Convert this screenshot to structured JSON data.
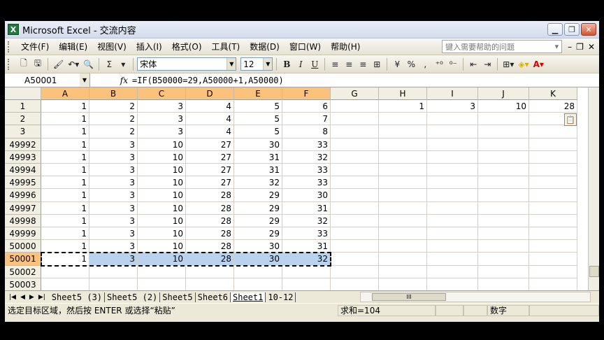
{
  "window": {
    "title": "Microsoft Excel - 交流内容"
  },
  "menu": {
    "items": [
      "文件(F)",
      "编辑(E)",
      "视图(V)",
      "插入(I)",
      "格式(O)",
      "工具(T)",
      "数据(D)",
      "窗口(W)",
      "帮助(H)"
    ],
    "help_placeholder": "键入需要帮助的问题"
  },
  "toolbar": {
    "font": "宋体",
    "size": "12",
    "sum_label": "Σ",
    "bold": "B",
    "italic": "I",
    "underline": "U",
    "percent": "%",
    "comma": ","
  },
  "formula_bar": {
    "name_box": "A50001",
    "fx": "fx",
    "formula": "=IF(B50000=29,A50000+1,A50000)"
  },
  "grid": {
    "columns": [
      "A",
      "B",
      "C",
      "D",
      "E",
      "F",
      "G",
      "H",
      "I",
      "J",
      "K"
    ],
    "rows": [
      {
        "label": "1",
        "cells": [
          "1",
          "2",
          "3",
          "4",
          "5",
          "6",
          "",
          "1",
          "3",
          "10",
          "28"
        ]
      },
      {
        "label": "2",
        "cells": [
          "1",
          "2",
          "3",
          "4",
          "5",
          "7",
          "",
          "",
          "",
          "",
          ""
        ]
      },
      {
        "label": "3",
        "cells": [
          "1",
          "2",
          "3",
          "4",
          "5",
          "8",
          "",
          "",
          "",
          "",
          ""
        ]
      },
      {
        "label": "49992",
        "cells": [
          "1",
          "3",
          "10",
          "27",
          "30",
          "33",
          "",
          "",
          "",
          "",
          ""
        ]
      },
      {
        "label": "49993",
        "cells": [
          "1",
          "3",
          "10",
          "27",
          "31",
          "32",
          "",
          "",
          "",
          "",
          ""
        ]
      },
      {
        "label": "49994",
        "cells": [
          "1",
          "3",
          "10",
          "27",
          "31",
          "33",
          "",
          "",
          "",
          "",
          ""
        ]
      },
      {
        "label": "49995",
        "cells": [
          "1",
          "3",
          "10",
          "27",
          "32",
          "33",
          "",
          "",
          "",
          "",
          ""
        ]
      },
      {
        "label": "49996",
        "cells": [
          "1",
          "3",
          "10",
          "28",
          "29",
          "30",
          "",
          "",
          "",
          "",
          ""
        ]
      },
      {
        "label": "49997",
        "cells": [
          "1",
          "3",
          "10",
          "28",
          "29",
          "31",
          "",
          "",
          "",
          "",
          ""
        ]
      },
      {
        "label": "49998",
        "cells": [
          "1",
          "3",
          "10",
          "28",
          "29",
          "32",
          "",
          "",
          "",
          "",
          ""
        ]
      },
      {
        "label": "49999",
        "cells": [
          "1",
          "3",
          "10",
          "28",
          "29",
          "33",
          "",
          "",
          "",
          "",
          ""
        ]
      },
      {
        "label": "50000",
        "cells": [
          "1",
          "3",
          "10",
          "28",
          "30",
          "31",
          "",
          "",
          "",
          "",
          ""
        ]
      },
      {
        "label": "50001",
        "cells": [
          "1",
          "3",
          "10",
          "28",
          "30",
          "32",
          "",
          "",
          "",
          "",
          ""
        ]
      },
      {
        "label": "50002",
        "cells": [
          "",
          "",
          "",
          "",
          "",
          "",
          "",
          "",
          "",
          "",
          ""
        ]
      },
      {
        "label": "50003",
        "cells": [
          "",
          "",
          "",
          "",
          "",
          "",
          "",
          "",
          "",
          "",
          ""
        ]
      }
    ],
    "selected_row": "50001",
    "selected_columns": [
      "A",
      "B",
      "C",
      "D",
      "E",
      "F"
    ]
  },
  "sheet_tabs": [
    "Sheet5 (3)",
    "Sheet5 (2)",
    "Sheet5",
    "Sheet6",
    "Sheet1",
    "10-12"
  ],
  "active_tab": "Sheet1",
  "hscroll_thumb": "III",
  "status": {
    "message": "选定目标区域，然后按 ENTER 或选择“粘贴”",
    "sum": "求和=104",
    "mode": "数字"
  },
  "colors": {
    "header_selected": "#fcc27c",
    "selection_fill": "#b9d3ee"
  }
}
